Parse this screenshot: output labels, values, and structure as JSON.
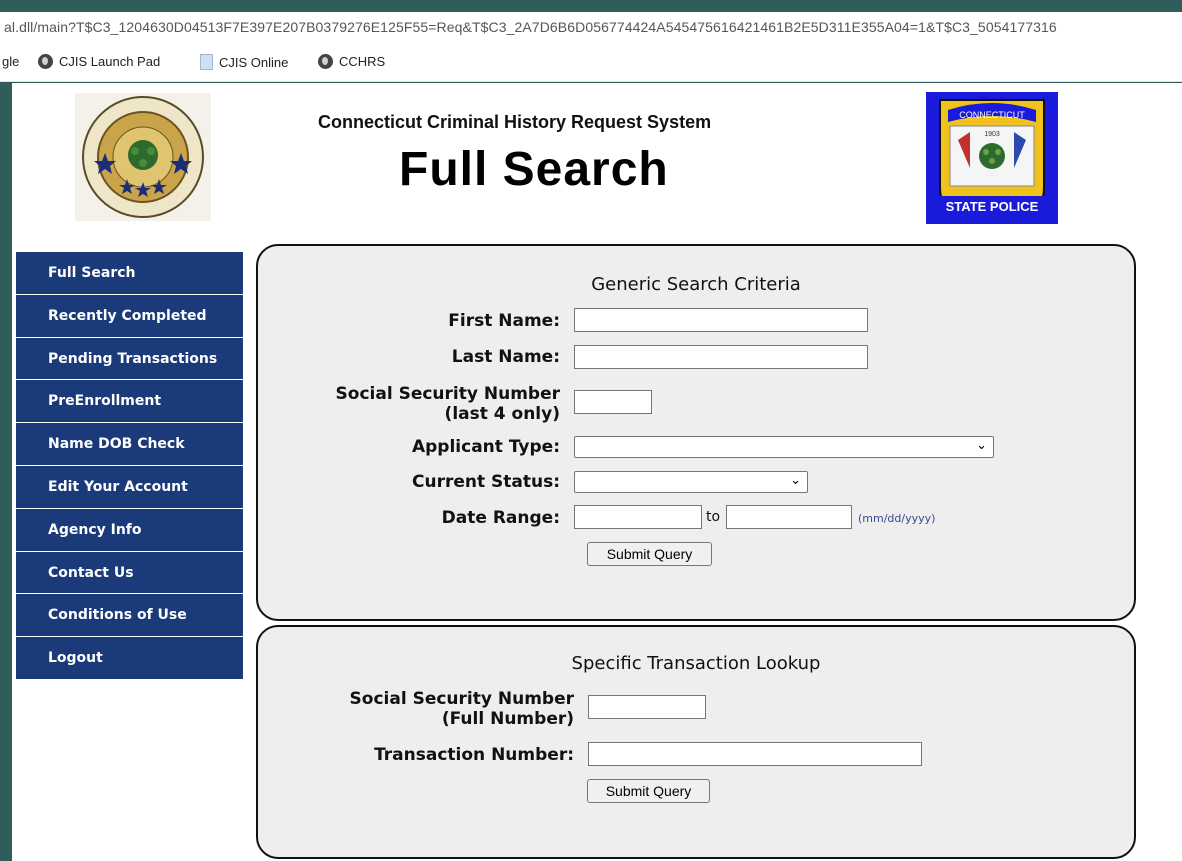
{
  "browser": {
    "url": "al.dll/main?T$C3_1204630D04513F7E397E207B0379276E125F55=Req&T$C3_2A7D6B6D056774424A545475616421461B2E5D311E355A04=1&T$C3_5054177316",
    "bookmarks": [
      "gle",
      "CJIS Launch Pad",
      "CJIS Online",
      "CCHRS"
    ]
  },
  "header": {
    "subtitle": "Connecticut Criminal History Request System",
    "title": "Full Search",
    "badge": {
      "top": "CONNECTICUT",
      "year": "1903",
      "bottom": "STATE POLICE"
    }
  },
  "sidebar": {
    "items": [
      {
        "label": "Full Search"
      },
      {
        "label": "Recently Completed"
      },
      {
        "label": "Pending Transactions"
      },
      {
        "label": "PreEnrollment"
      },
      {
        "label": "Name DOB Check"
      },
      {
        "label": "Edit Your Account"
      },
      {
        "label": "Agency Info"
      },
      {
        "label": "Contact Us"
      },
      {
        "label": "Conditions of Use"
      },
      {
        "label": "Logout"
      }
    ]
  },
  "generic": {
    "title": "Generic Search Criteria",
    "first_name_label": "First Name:",
    "first_name_value": "",
    "last_name_label": "Last Name:",
    "last_name_value": "",
    "ssn_label_1": "Social Security Number",
    "ssn_label_2": "(last 4 only)",
    "ssn_value": "",
    "applicant_type_label": "Applicant Type:",
    "applicant_type_value": "",
    "current_status_label": "Current Status:",
    "current_status_value": "",
    "date_range_label": "Date Range:",
    "date_from": "",
    "to_label": "to",
    "date_to": "",
    "date_hint": "(mm/dd/yyyy)",
    "submit_label": "Submit Query"
  },
  "specific": {
    "title": "Specific Transaction Lookup",
    "ssn_label_1": "Social Security Number",
    "ssn_label_2": "(Full Number)",
    "ssn_value": "",
    "txn_label": "Transaction Number:",
    "txn_value": "",
    "submit_label": "Submit Query"
  },
  "colors": {
    "sidebar_bg": "#1b3a7a",
    "panel_bg": "#eeeeee",
    "badge_bg": "#1a1adb",
    "outer_bg": "#2f5d5a"
  }
}
